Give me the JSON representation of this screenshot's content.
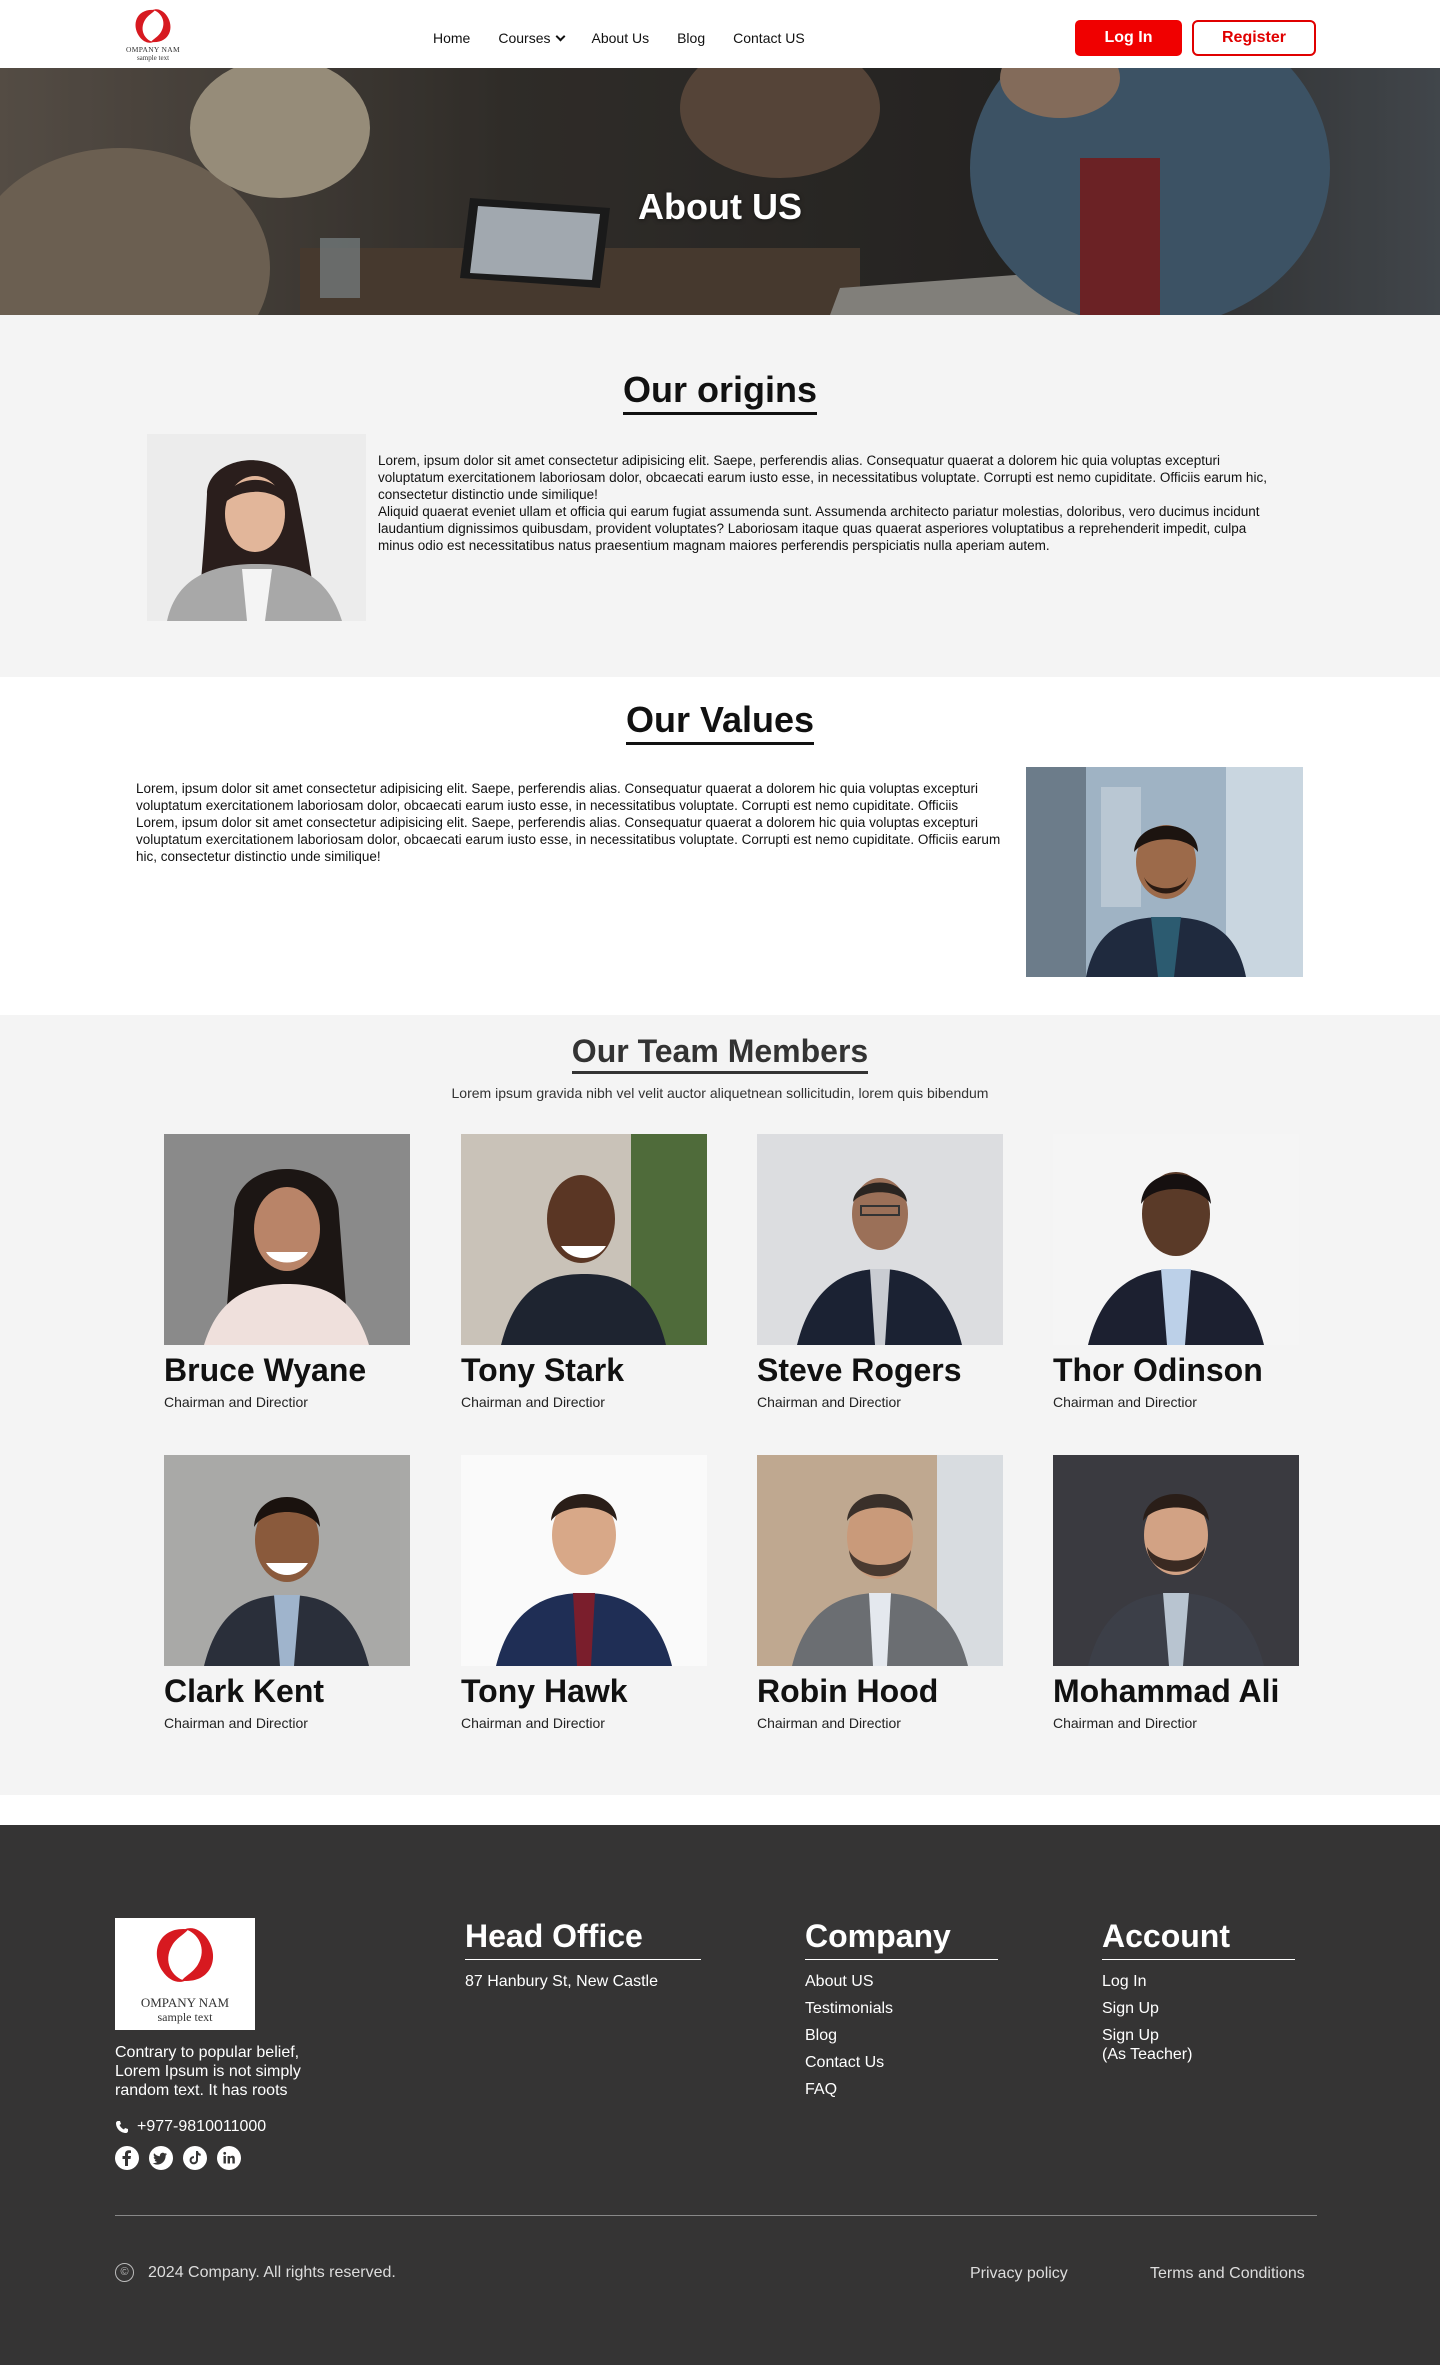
{
  "nav": {
    "logo_line1": "OMPANY NAM",
    "logo_line2": "sample text",
    "menu": [
      "Home",
      "Courses",
      "About Us",
      "Blog",
      "Contact US"
    ],
    "login": "Log In",
    "register": "Register"
  },
  "hero": {
    "title": "About US"
  },
  "origins": {
    "title": "Our origins",
    "p1": "Lorem, ipsum dolor sit amet consectetur adipisicing elit. Saepe, perferendis alias. Consequatur quaerat a dolorem hic quia voluptas excepturi voluptatum exercitationem laboriosam dolor, obcaecati earum iusto esse, in necessitatibus voluptate. Corrupti est nemo cupiditate. Officiis earum hic, consectetur distinctio unde similique!",
    "p2": "Aliquid quaerat eveniet ullam et officia qui earum fugiat assumenda sunt. Assumenda architecto pariatur molestias, doloribus, vero ducimus incidunt laudantium dignissimos quibusdam, provident voluptates? Laboriosam itaque quas quaerat asperiores voluptatibus a reprehenderit impedit, culpa minus odio est necessitatibus natus praesentium magnam maiores perferendis perspiciatis nulla aperiam autem."
  },
  "values": {
    "title": "Our Values",
    "p1": "Lorem, ipsum dolor sit amet consectetur adipisicing elit. Saepe, perferendis alias. Consequatur quaerat a dolorem hic quia voluptas excepturi voluptatum exercitationem laboriosam dolor, obcaecati earum iusto esse, in necessitatibus voluptate. Corrupti est nemo cupiditate. Officiis",
    "p2": "Lorem, ipsum dolor sit amet consectetur adipisicing elit. Saepe, perferendis alias. Consequatur quaerat a dolorem hic quia voluptas excepturi voluptatum exercitationem laboriosam dolor, obcaecati earum iusto esse, in necessitatibus voluptate. Corrupti est nemo cupiditate. Officiis earum hic, consectetur distinctio unde similique!"
  },
  "team": {
    "title": "Our Team Members",
    "subtitle": "Lorem ipsum gravida nibh vel velit auctor aliquetnean sollicitudin, lorem quis bibendum",
    "members": [
      {
        "name": "Bruce Wyane",
        "role": "Chairman and Directior"
      },
      {
        "name": "Tony Stark",
        "role": "Chairman and Directior"
      },
      {
        "name": "Steve Rogers",
        "role": "Chairman and Directior"
      },
      {
        "name": "Thor Odinson",
        "role": "Chairman and Directior"
      },
      {
        "name": "Clark Kent",
        "role": "Chairman and Directior"
      },
      {
        "name": "Tony Hawk",
        "role": "Chairman and Directior"
      },
      {
        "name": "Robin Hood",
        "role": "Chairman and Directior"
      },
      {
        "name": "Mohammad Ali",
        "role": "Chairman and Directior"
      }
    ]
  },
  "footer": {
    "logo_line1": "OMPANY NAM",
    "logo_line2": "sample text",
    "about": "Contrary to popular belief, Lorem Ipsum is not simply random text. It has roots",
    "phone": "+977-9810011000",
    "social_icons": [
      "facebook-icon",
      "twitter-icon",
      "tiktok-icon",
      "linkedin-icon"
    ],
    "head_office": {
      "title": "Head Office",
      "address": "87 Hanbury St, New Castle"
    },
    "company": {
      "title": "Company",
      "links": [
        "About US",
        "Testimonials",
        "Blog",
        "Contact Us",
        "FAQ"
      ]
    },
    "account": {
      "title": "Account",
      "links": [
        "Log In",
        "Sign Up"
      ],
      "teacher_line1": "Sign Up",
      "teacher_line2": "(As Teacher)"
    },
    "copyright": "2024 Company. All rights reserved.",
    "privacy": "Privacy policy",
    "terms": "Terms and Conditions"
  },
  "colors": {
    "brand_red": "#f00000",
    "footer_bg": "#353434",
    "section_gray": "#f4f4f4"
  }
}
